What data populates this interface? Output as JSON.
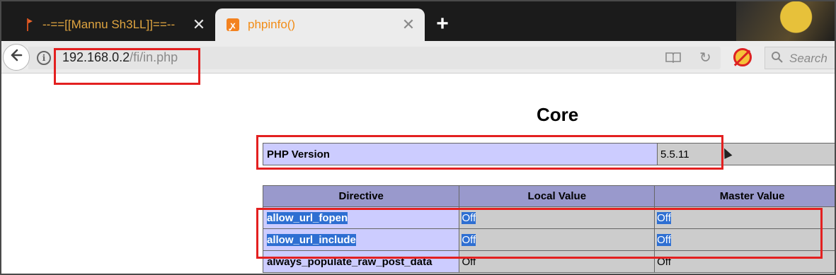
{
  "tabs": [
    {
      "label": "--==[[Mannu Sh3LL]]==--",
      "active": false
    },
    {
      "label": "phpinfo()",
      "active": true
    }
  ],
  "tab_close_symbol": "✕",
  "new_tab_symbol": "+",
  "address": {
    "host": "192.168.0.2",
    "path": "/fi/in.php"
  },
  "search": {
    "placeholder": "Search"
  },
  "page": {
    "heading": "Core",
    "version_label": "PHP Version",
    "version_value": "5.5.11",
    "columns": [
      "Directive",
      "Local Value",
      "Master Value"
    ],
    "rows": [
      {
        "directive": "allow_url_fopen",
        "local": "Off",
        "master": "Off"
      },
      {
        "directive": "allow_url_include",
        "local": "Off",
        "master": "Off"
      },
      {
        "directive": "always_populate_raw_post_data",
        "local": "Off",
        "master": "Off"
      }
    ]
  },
  "colors": {
    "tab_active_text": "#f28c16",
    "tab_inactive_text": "#e0a540",
    "annotation": "#e32020",
    "php_header": "#9999cc",
    "php_key": "#ccccff",
    "php_value": "#cccccc",
    "selection": "#2e6fd2"
  },
  "icons": {
    "tab1": "flag-icon",
    "tab2": "xampp-icon",
    "back": "back-arrow-icon",
    "info": "info-icon",
    "reader": "reader-view-icon",
    "reload": "reload-icon",
    "addon": "blocked-addon-icon",
    "search": "search-icon"
  }
}
